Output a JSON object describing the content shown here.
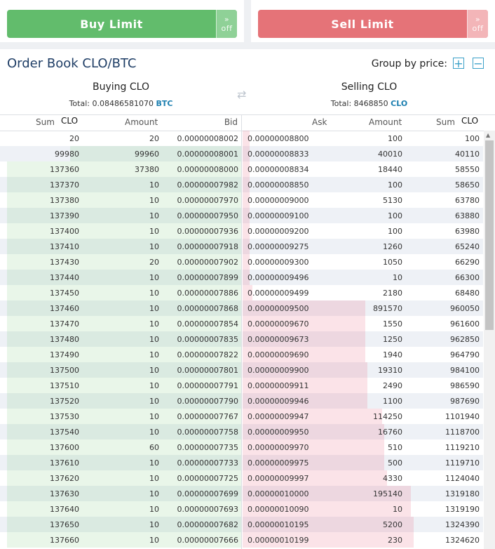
{
  "buttons": {
    "buy_label": "Buy  Limit",
    "sell_label": "Sell  Limit",
    "toggle_text": "off"
  },
  "header": {
    "title": "Order Book CLO/BTC",
    "group_label": "Group by price:",
    "group_plus": "+",
    "group_minus": "−"
  },
  "buying": {
    "title": "Buying CLO",
    "total_label": "Total:",
    "total_value": "0.08486581070",
    "total_currency": "BTC",
    "col_sum": "Sum",
    "col_unit": "CLO",
    "col_amount": "Amount",
    "col_price": "Bid",
    "rows": [
      {
        "sum": "20",
        "amount": "20",
        "price": "0.00000008002",
        "depth": 0.0
      },
      {
        "sum": "99980",
        "amount": "99960",
        "price": "0.00000008001",
        "depth": 0.73
      },
      {
        "sum": "137360",
        "amount": "37380",
        "price": "0.00000008000",
        "depth": 1.0
      },
      {
        "sum": "137370",
        "amount": "10",
        "price": "0.00000007982",
        "depth": 1.0
      },
      {
        "sum": "137380",
        "amount": "10",
        "price": "0.00000007970",
        "depth": 1.0
      },
      {
        "sum": "137390",
        "amount": "10",
        "price": "0.00000007950",
        "depth": 1.0
      },
      {
        "sum": "137400",
        "amount": "10",
        "price": "0.00000007936",
        "depth": 1.0
      },
      {
        "sum": "137410",
        "amount": "10",
        "price": "0.00000007918",
        "depth": 1.0
      },
      {
        "sum": "137430",
        "amount": "20",
        "price": "0.00000007902",
        "depth": 1.0
      },
      {
        "sum": "137440",
        "amount": "10",
        "price": "0.00000007899",
        "depth": 1.0
      },
      {
        "sum": "137450",
        "amount": "10",
        "price": "0.00000007886",
        "depth": 1.0
      },
      {
        "sum": "137460",
        "amount": "10",
        "price": "0.00000007868",
        "depth": 1.0
      },
      {
        "sum": "137470",
        "amount": "10",
        "price": "0.00000007854",
        "depth": 1.0
      },
      {
        "sum": "137480",
        "amount": "10",
        "price": "0.00000007835",
        "depth": 1.0
      },
      {
        "sum": "137490",
        "amount": "10",
        "price": "0.00000007822",
        "depth": 1.0
      },
      {
        "sum": "137500",
        "amount": "10",
        "price": "0.00000007801",
        "depth": 1.0
      },
      {
        "sum": "137510",
        "amount": "10",
        "price": "0.00000007791",
        "depth": 1.0
      },
      {
        "sum": "137520",
        "amount": "10",
        "price": "0.00000007790",
        "depth": 1.0
      },
      {
        "sum": "137530",
        "amount": "10",
        "price": "0.00000007767",
        "depth": 1.0
      },
      {
        "sum": "137540",
        "amount": "10",
        "price": "0.00000007758",
        "depth": 1.0
      },
      {
        "sum": "137600",
        "amount": "60",
        "price": "0.00000007735",
        "depth": 1.0
      },
      {
        "sum": "137610",
        "amount": "10",
        "price": "0.00000007733",
        "depth": 1.0
      },
      {
        "sum": "137620",
        "amount": "10",
        "price": "0.00000007725",
        "depth": 1.0
      },
      {
        "sum": "137630",
        "amount": "10",
        "price": "0.00000007699",
        "depth": 1.0
      },
      {
        "sum": "137640",
        "amount": "10",
        "price": "0.00000007693",
        "depth": 1.0
      },
      {
        "sum": "137650",
        "amount": "10",
        "price": "0.00000007682",
        "depth": 1.0
      },
      {
        "sum": "137660",
        "amount": "10",
        "price": "0.00000007666",
        "depth": 1.0
      }
    ]
  },
  "selling": {
    "title": "Selling CLO",
    "total_label": "Total:",
    "total_value": "8468850",
    "total_currency": "CLO",
    "col_price": "Ask",
    "col_amount": "Amount",
    "col_sum": "Sum",
    "col_unit": "CLO",
    "rows": [
      {
        "price": "0.00000008800",
        "amount": "100",
        "sum": "100",
        "depth": 0.0
      },
      {
        "price": "0.00000008833",
        "amount": "40010",
        "sum": "40110",
        "depth": 0.02
      },
      {
        "price": "0.00000008834",
        "amount": "18440",
        "sum": "58550",
        "depth": 0.03
      },
      {
        "price": "0.00000008850",
        "amount": "100",
        "sum": "58650",
        "depth": 0.03
      },
      {
        "price": "0.00000009000",
        "amount": "5130",
        "sum": "63780",
        "depth": 0.03
      },
      {
        "price": "0.00000009100",
        "amount": "100",
        "sum": "63880",
        "depth": 0.03
      },
      {
        "price": "0.00000009200",
        "amount": "100",
        "sum": "63980",
        "depth": 0.03
      },
      {
        "price": "0.00000009275",
        "amount": "1260",
        "sum": "65240",
        "depth": 0.03
      },
      {
        "price": "0.00000009300",
        "amount": "1050",
        "sum": "66290",
        "depth": 0.03
      },
      {
        "price": "0.00000009496",
        "amount": "10",
        "sum": "66300",
        "depth": 0.03
      },
      {
        "price": "0.00000009499",
        "amount": "2180",
        "sum": "68480",
        "depth": 0.04
      },
      {
        "price": "0.00000009500",
        "amount": "891570",
        "sum": "960050",
        "depth": 0.51
      },
      {
        "price": "0.00000009670",
        "amount": "1550",
        "sum": "961600",
        "depth": 0.51
      },
      {
        "price": "0.00000009673",
        "amount": "1250",
        "sum": "962850",
        "depth": 0.51
      },
      {
        "price": "0.00000009690",
        "amount": "1940",
        "sum": "964790",
        "depth": 0.51
      },
      {
        "price": "0.00000009900",
        "amount": "19310",
        "sum": "984100",
        "depth": 0.52
      },
      {
        "price": "0.00000009911",
        "amount": "2490",
        "sum": "986590",
        "depth": 0.52
      },
      {
        "price": "0.00000009946",
        "amount": "1100",
        "sum": "987690",
        "depth": 0.52
      },
      {
        "price": "0.00000009947",
        "amount": "114250",
        "sum": "1101940",
        "depth": 0.58
      },
      {
        "price": "0.00000009950",
        "amount": "16760",
        "sum": "1118700",
        "depth": 0.59
      },
      {
        "price": "0.00000009970",
        "amount": "510",
        "sum": "1119210",
        "depth": 0.59
      },
      {
        "price": "0.00000009975",
        "amount": "500",
        "sum": "1119710",
        "depth": 0.59
      },
      {
        "price": "0.00000009997",
        "amount": "4330",
        "sum": "1124040",
        "depth": 0.6
      },
      {
        "price": "0.00000010000",
        "amount": "195140",
        "sum": "1319180",
        "depth": 0.7
      },
      {
        "price": "0.00000010090",
        "amount": "10",
        "sum": "1319190",
        "depth": 0.7
      },
      {
        "price": "0.00000010195",
        "amount": "5200",
        "sum": "1324390",
        "depth": 0.71
      },
      {
        "price": "0.00000010199",
        "amount": "230",
        "sum": "1324620",
        "depth": 0.71
      }
    ]
  }
}
